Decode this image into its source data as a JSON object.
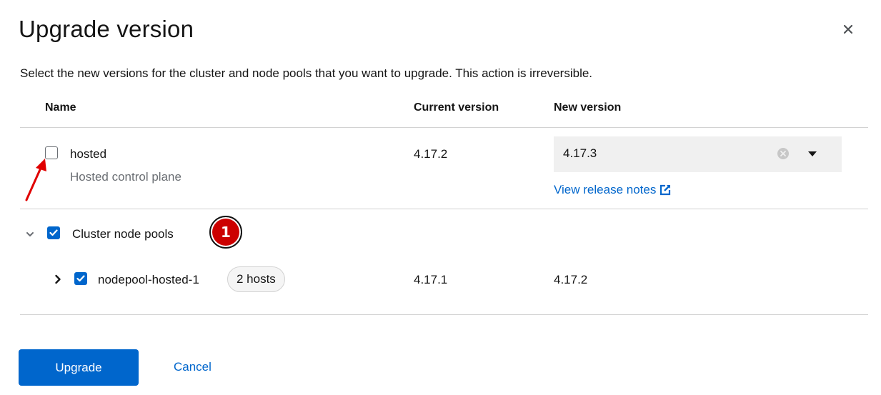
{
  "modal": {
    "title": "Upgrade version",
    "description": "Select the new versions for the cluster and node pools that you want to upgrade. This action is irreversible."
  },
  "table": {
    "headers": {
      "name": "Name",
      "current": "Current version",
      "new": "New version"
    },
    "hosted": {
      "name": "hosted",
      "subtitle": "Hosted control plane",
      "current_version": "4.17.2",
      "new_version": "4.17.3",
      "checked": false,
      "release_notes_label": "View release notes"
    },
    "node_pools": {
      "label": "Cluster node pools",
      "checked": true,
      "expanded": true,
      "items": [
        {
          "name": "nodepool-hosted-1",
          "hosts_badge": "2 hosts",
          "current_version": "4.17.1",
          "new_version": "4.17.2",
          "checked": true,
          "expanded": false
        }
      ]
    }
  },
  "annotation": {
    "step_number": "1",
    "color": "#cc0000"
  },
  "footer": {
    "upgrade_label": "Upgrade",
    "cancel_label": "Cancel"
  },
  "colors": {
    "primary": "#0066cc",
    "text": "#151515",
    "muted": "#6a6e73",
    "divider": "#d2d2d2",
    "select_bg": "#f0f0f0",
    "annotation": "#cc0000"
  },
  "icons": [
    "close-icon",
    "checkbox-icon",
    "clear-icon",
    "caret-down-icon",
    "external-link-icon",
    "chevron-down-icon",
    "chevron-right-icon",
    "annotation-arrow"
  ]
}
